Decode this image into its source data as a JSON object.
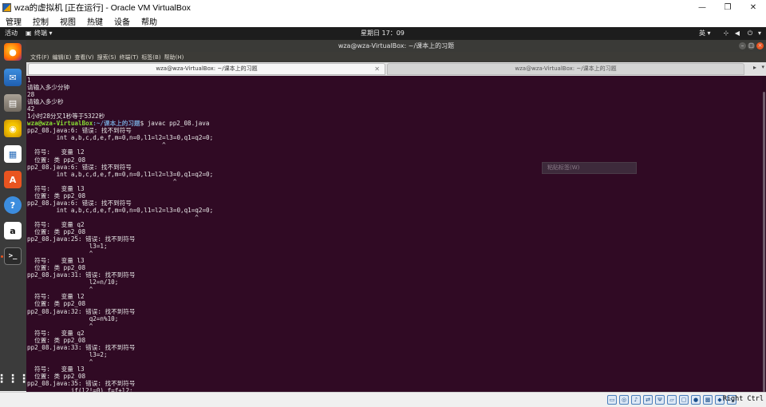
{
  "host": {
    "title": "wza的虚拟机 [正在运行] - Oracle VM VirtualBox",
    "minimize_icon": "—",
    "restore_icon": "❐",
    "close_icon": "✕",
    "menu": [
      "管理",
      "控制",
      "视图",
      "热键",
      "设备",
      "帮助"
    ],
    "host_key": "Right Ctrl"
  },
  "guest_topbar": {
    "activities": "活动",
    "app_menu": "终端 ▾",
    "clock": "星期日 17：09",
    "input_method": "英 ▾",
    "tray_icons": [
      "network-icon",
      "volume-icon",
      "power-icon"
    ]
  },
  "dock": {
    "apps": [
      "firefox-icon",
      "thunderbird-icon",
      "files-icon",
      "rhythmbox-icon",
      "libreoffice-writer-icon",
      "ubuntu-software-icon",
      "help-icon",
      "amazon-icon",
      "terminal-icon"
    ],
    "show_apps_icon": "grid-icon"
  },
  "terminal": {
    "window_title": "wza@wza-VirtualBox: ~/课本上的习题",
    "menu": [
      "文件(F)",
      "编辑(E)",
      "查看(V)",
      "搜索(S)",
      "终端(T)",
      "标签(B)",
      "帮助(H)"
    ],
    "tabs": [
      {
        "label": "wza@wza-VirtualBox: ~/课本上的习题",
        "active": true
      },
      {
        "label": "wza@wza-VirtualBox: ~/课本上的习题",
        "active": false
      }
    ],
    "ghost_menu_item": "粘贴标签(W)",
    "lines": [
      {
        "t": "1"
      },
      {
        "t": "请输入多少分钟"
      },
      {
        "t": "28"
      },
      {
        "t": "请输入多少秒"
      },
      {
        "t": "42"
      },
      {
        "t": "1小时28分又1秒等于5322秒"
      },
      {
        "prompt_user": "wza@wza-VirtualBox",
        "prompt_path": ":~/课本上的习题",
        "cmd": "$ javac pp2_08.java"
      },
      {
        "t": "pp2_08.java:6: 错误: 找不到符号"
      },
      {
        "t": "        int a,b,c,d,e,f,m=0,n=0,l1=l2=l3=0,q1=q2=0;"
      },
      {
        "t": "                                     ^"
      },
      {
        "t": "  符号:   变量 l2"
      },
      {
        "t": "  位置: 类 pp2_08"
      },
      {
        "t": "pp2_08.java:6: 错误: 找不到符号"
      },
      {
        "t": "        int a,b,c,d,e,f,m=0,n=0,l1=l2=l3=0,q1=q2=0;"
      },
      {
        "t": "                                        ^"
      },
      {
        "t": "  符号:   变量 l3"
      },
      {
        "t": "  位置: 类 pp2_08"
      },
      {
        "t": "pp2_08.java:6: 错误: 找不到符号"
      },
      {
        "t": "        int a,b,c,d,e,f,m=0,n=0,l1=l2=l3=0,q1=q2=0;"
      },
      {
        "t": "                                              ^"
      },
      {
        "t": "  符号:   变量 q2"
      },
      {
        "t": "  位置: 类 pp2_08"
      },
      {
        "t": "pp2_08.java:25: 错误: 找不到符号"
      },
      {
        "t": "                 l3=1;"
      },
      {
        "t": "                 ^"
      },
      {
        "t": "  符号:   变量 l3"
      },
      {
        "t": "  位置: 类 pp2_08"
      },
      {
        "t": "pp2_08.java:31: 错误: 找不到符号"
      },
      {
        "t": "                 l2=n/10;"
      },
      {
        "t": "                 ^"
      },
      {
        "t": "  符号:   变量 l2"
      },
      {
        "t": "  位置: 类 pp2_08"
      },
      {
        "t": "pp2_08.java:32: 错误: 找不到符号"
      },
      {
        "t": "                 q2=n%10;"
      },
      {
        "t": "                 ^"
      },
      {
        "t": "  符号:   变量 q2"
      },
      {
        "t": "  位置: 类 pp2_08"
      },
      {
        "t": "pp2_08.java:33: 错误: 找不到符号"
      },
      {
        "t": "                 l3=2;"
      },
      {
        "t": "                 ^"
      },
      {
        "t": "  符号:   变量 l3"
      },
      {
        "t": "  位置: 类 pp2_08"
      },
      {
        "t": "pp2_08.java:35: 错误: 找不到符号"
      },
      {
        "t": "            if(l2!=0) f=f+l2;"
      }
    ]
  },
  "statusbar": {
    "icons": [
      "hard-disk-icon",
      "optical-drive-icon",
      "audio-icon",
      "network-icon",
      "usb-icon",
      "shared-folders-icon",
      "display-icon",
      "video-capture-icon",
      "cpu-icon",
      "mouse-integration-icon",
      "host-key-arrow-icon"
    ]
  }
}
